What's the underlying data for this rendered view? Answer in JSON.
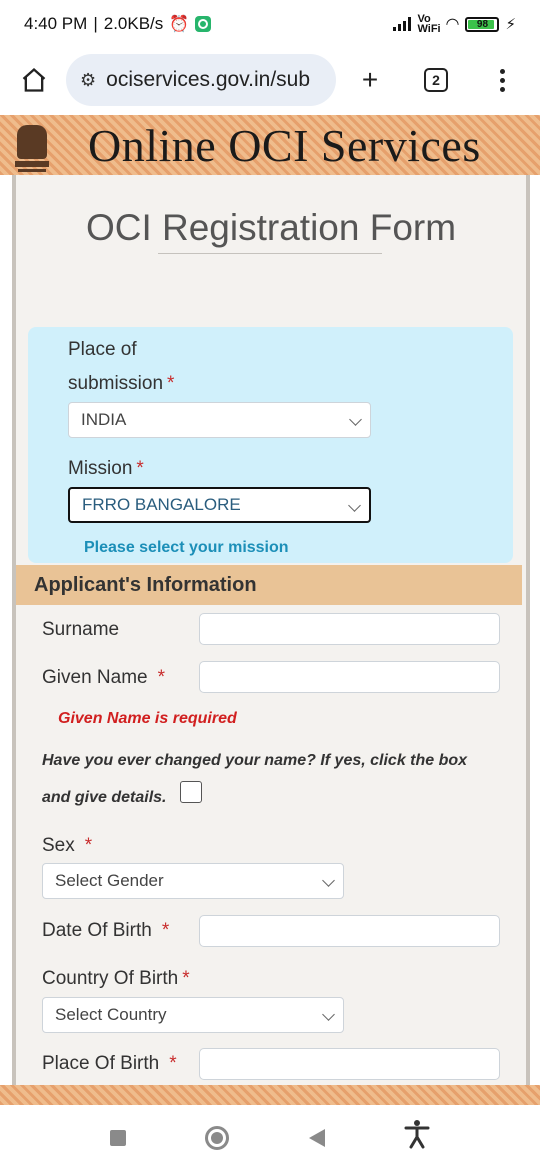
{
  "status_bar": {
    "time": "4:40 PM",
    "network_speed": "2.0KB/s",
    "signal_label": "Vo WiFi",
    "battery": "98"
  },
  "browser": {
    "url": "ociservices.gov.in/sub",
    "tab_count": "2",
    "new_tab_symbol": "+"
  },
  "banner": {
    "title": "Online OCI Services"
  },
  "form": {
    "title": "OCI Registration Form",
    "place_of_submission": {
      "label_line1": "Place of",
      "label_line2": "submission",
      "required": "*",
      "selected": "INDIA"
    },
    "mission": {
      "label": "Mission",
      "required": "*",
      "selected": "FRRO BANGALORE",
      "hint": "Please select your mission"
    },
    "applicant_section": {
      "heading": "Applicant's Information",
      "surname_label": "Surname",
      "given_name_label": "Given Name",
      "given_name_error": "Given Name is required",
      "name_change_question_line1": "Have you ever changed your name? If yes, click the box",
      "name_change_question_line2": "and give details.",
      "sex_label": "Sex",
      "sex_placeholder": "Select Gender",
      "dob_label": "Date Of Birth",
      "country_of_birth_label": "Country Of Birth",
      "country_placeholder": "Select Country",
      "place_of_birth_label": "Place Of Birth",
      "required": "*"
    }
  },
  "colors": {
    "banner": "#e8a770",
    "blue_box": "#d0f0fb",
    "section_header": "#e9c396",
    "hint": "#1c8fb8",
    "error": "#d11f1f"
  },
  "icons": [
    "home-icon",
    "site-settings-icon",
    "new-tab-icon",
    "tabs-icon",
    "menu-icon",
    "alarm-icon",
    "shield-icon",
    "wifi-icon",
    "battery-icon",
    "charging-icon",
    "recent-apps-icon",
    "home-nav-icon",
    "back-icon",
    "accessibility-icon"
  ]
}
